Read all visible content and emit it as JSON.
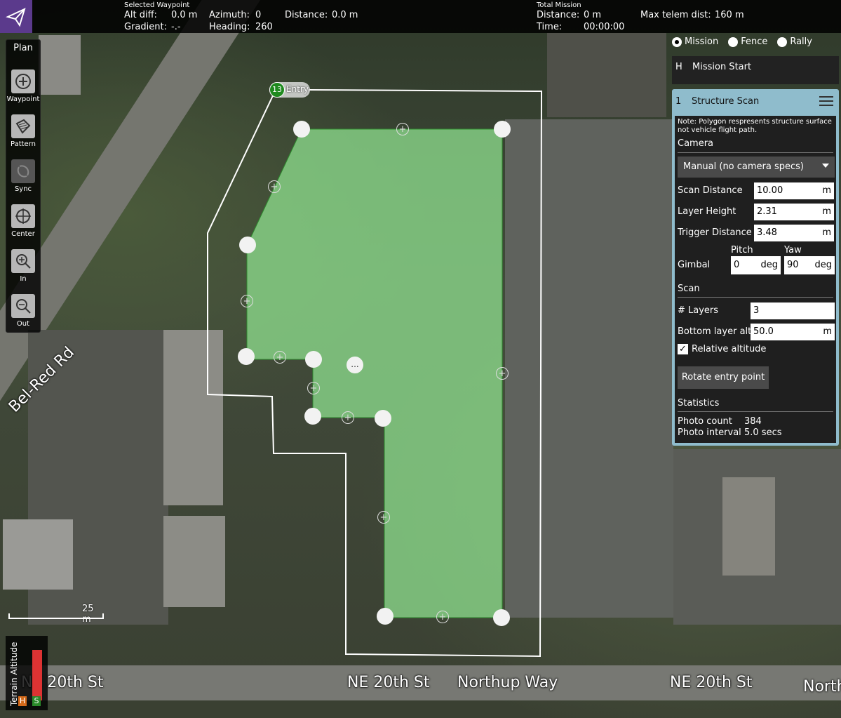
{
  "topbar": {
    "selected_waypoint_heading": "Selected Waypoint",
    "alt_diff_label": "Alt diff:",
    "alt_diff_value": "0.0 m",
    "gradient_label": "Gradient:",
    "gradient_value": "-.-",
    "azimuth_label": "Azimuth:",
    "azimuth_value": "0",
    "heading_label": "Heading:",
    "heading_value": "260",
    "distance_label": "Distance:",
    "distance_value": "0.0 m",
    "total_mission_heading": "Total Mission",
    "total_distance_label": "Distance:",
    "total_distance_value": "0 m",
    "time_label": "Time:",
    "time_value": "00:00:00",
    "max_telem_label": "Max telem dist:",
    "max_telem_value": "160 m"
  },
  "toolstrip": {
    "title": "Plan",
    "tools": [
      {
        "label": "Waypoint",
        "icon": "plus-circle-icon"
      },
      {
        "label": "Pattern",
        "icon": "pattern-icon"
      },
      {
        "label": "Sync",
        "icon": "sync-icon"
      },
      {
        "label": "Center",
        "icon": "crosshair-icon"
      },
      {
        "label": "In",
        "icon": "zoom-in-icon"
      },
      {
        "label": "Out",
        "icon": "zoom-out-icon"
      }
    ]
  },
  "layers": {
    "mission": "Mission",
    "fence": "Fence",
    "rally": "Rally",
    "selected": "Mission"
  },
  "mission_start": {
    "index": "H",
    "label": "Mission Start"
  },
  "structure_scan": {
    "index": "1",
    "title": "Structure Scan",
    "note": "Note: Polygon respresents structure surface not vehicle flight path.",
    "camera_section": "Camera",
    "camera_select": "Manual (no camera specs)",
    "scan_distance_label": "Scan Distance",
    "scan_distance_value": "10.00",
    "layer_height_label": "Layer Height",
    "layer_height_value": "2.31",
    "trigger_distance_label": "Trigger Distance",
    "trigger_distance_value": "3.48",
    "unit_m": "m",
    "gimbal_label": "Gimbal",
    "pitch_label": "Pitch",
    "pitch_value": "0",
    "yaw_label": "Yaw",
    "yaw_value": "90",
    "unit_deg": "deg",
    "scan_section": "Scan",
    "layers_label": "# Layers",
    "layers_value": "3",
    "bottom_alt_label": "Bottom layer alt",
    "bottom_alt_value": "50.0",
    "relative_alt_label": "Relative altitude",
    "relative_alt_checked": true,
    "rotate_button": "Rotate entry point",
    "statistics_section": "Statistics",
    "photo_count_label": "Photo count",
    "photo_count_value": "384",
    "photo_interval_label": "Photo interval",
    "photo_interval_value": "5.0 secs"
  },
  "map": {
    "entry_index": "13",
    "entry_label": "Entry",
    "more_label": "...",
    "scale_label": "25 m",
    "streets": {
      "bel_red": "Bel-Red Rd",
      "ne20_left": "NE 20th St",
      "ne20_center": "NE 20th St",
      "northup": "Northup Way",
      "ne20_right": "NE 20th St",
      "north_cut": "North"
    }
  },
  "terrain": {
    "label": "Terrain Altitude",
    "h": "H",
    "s": "S"
  },
  "colors": {
    "accent_purple": "#5b3a8c",
    "panel_blue": "#8fbccc",
    "polygon_green": "#7fd27f",
    "entry_green": "#1f8a1f"
  }
}
